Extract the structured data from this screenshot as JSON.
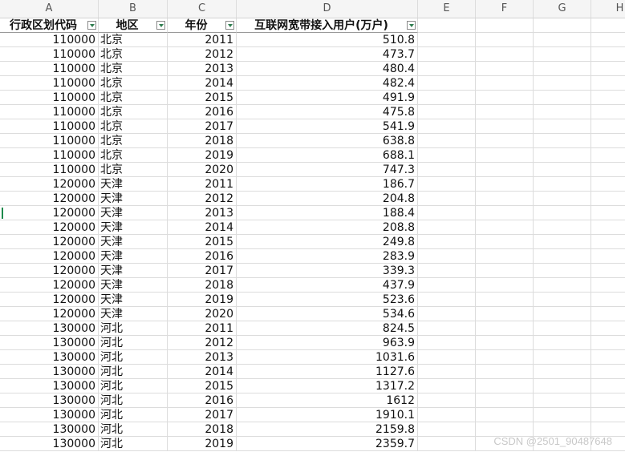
{
  "columns": [
    "A",
    "B",
    "C",
    "D",
    "E",
    "F",
    "G",
    "H"
  ],
  "table": {
    "headers": [
      "行政区划代码",
      "地区",
      "年份",
      "互联网宽带接入用户(万户)"
    ],
    "rows": [
      [
        "110000",
        "北京",
        "2011",
        "510.8"
      ],
      [
        "110000",
        "北京",
        "2012",
        "473.7"
      ],
      [
        "110000",
        "北京",
        "2013",
        "480.4"
      ],
      [
        "110000",
        "北京",
        "2014",
        "482.4"
      ],
      [
        "110000",
        "北京",
        "2015",
        "491.9"
      ],
      [
        "110000",
        "北京",
        "2016",
        "475.8"
      ],
      [
        "110000",
        "北京",
        "2017",
        "541.9"
      ],
      [
        "110000",
        "北京",
        "2018",
        "638.8"
      ],
      [
        "110000",
        "北京",
        "2019",
        "688.1"
      ],
      [
        "110000",
        "北京",
        "2020",
        "747.3"
      ],
      [
        "120000",
        "天津",
        "2011",
        "186.7"
      ],
      [
        "120000",
        "天津",
        "2012",
        "204.8"
      ],
      [
        "120000",
        "天津",
        "2013",
        "188.4"
      ],
      [
        "120000",
        "天津",
        "2014",
        "208.8"
      ],
      [
        "120000",
        "天津",
        "2015",
        "249.8"
      ],
      [
        "120000",
        "天津",
        "2016",
        "283.9"
      ],
      [
        "120000",
        "天津",
        "2017",
        "339.3"
      ],
      [
        "120000",
        "天津",
        "2018",
        "437.9"
      ],
      [
        "120000",
        "天津",
        "2019",
        "523.6"
      ],
      [
        "120000",
        "天津",
        "2020",
        "534.6"
      ],
      [
        "130000",
        "河北",
        "2011",
        "824.5"
      ],
      [
        "130000",
        "河北",
        "2012",
        "963.9"
      ],
      [
        "130000",
        "河北",
        "2013",
        "1031.6"
      ],
      [
        "130000",
        "河北",
        "2014",
        "1127.6"
      ],
      [
        "130000",
        "河北",
        "2015",
        "1317.2"
      ],
      [
        "130000",
        "河北",
        "2016",
        "1612"
      ],
      [
        "130000",
        "河北",
        "2017",
        "1910.1"
      ],
      [
        "130000",
        "河北",
        "2018",
        "2159.8"
      ],
      [
        "130000",
        "河北",
        "2019",
        "2359.7"
      ]
    ]
  },
  "watermark": "CSDN @2501_90487648",
  "colors": {
    "filter_arrow": "#2f7d4f",
    "active_cell_marker": "#1e8a4c"
  }
}
